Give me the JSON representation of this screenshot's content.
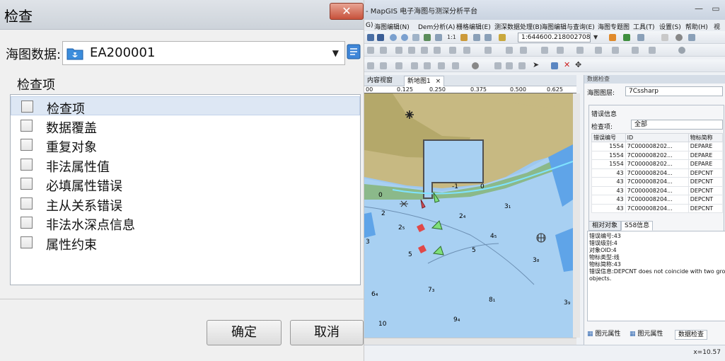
{
  "dialog": {
    "title": "检查",
    "close_glyph": "✕",
    "chart_data_label": "海图数据:",
    "chart_data_value": "EA200001",
    "group_label": "检查项",
    "items": [
      {
        "label": "检查项"
      },
      {
        "label": "数据覆盖"
      },
      {
        "label": "重复对象"
      },
      {
        "label": "非法属性值"
      },
      {
        "label": "必填属性错误"
      },
      {
        "label": "主从关系错误"
      },
      {
        "label": "非法水深点信息"
      },
      {
        "label": "属性约束"
      }
    ],
    "ok_label": "确定",
    "cancel_label": "取消"
  },
  "app": {
    "title": "- MapGIS 电子海图与测深分析平台",
    "menu": [
      "G)",
      "海图编辑(N)",
      "Dem分析(A)",
      "栅格编辑(E)",
      "测深数据处理(B)",
      "海图编辑与查询(E)",
      "海图专题图",
      "工具(T)",
      "设置(S)",
      "帮助(H)",
      "视"
    ],
    "scale_value": "1:644600.218002708",
    "tabs": [
      "内容视窗",
      "新地图1"
    ],
    "tab_close": "×",
    "ruler_ticks": [
      "00",
      "0.125",
      "0.250",
      "0.375",
      "0.500",
      "0.625"
    ],
    "map_labels": [
      "0",
      "2",
      "-1",
      "0",
      "2₄",
      "3₁",
      "2₅",
      "4₅",
      "3",
      "5",
      "5",
      "3₈",
      "6₄",
      "7₃",
      "8₁",
      "3₉",
      "9₄",
      "10"
    ],
    "panel": {
      "header": "数据检查",
      "layer_label": "海图图层:",
      "layer_value": "7Cssharp",
      "group_label": "错误信息",
      "check_label": "检查项:",
      "check_value": "全部",
      "columns": [
        "错误编号",
        "ID",
        "物标简称"
      ],
      "rows": [
        [
          "1554",
          "7C000008202...",
          "DEPARE"
        ],
        [
          "1554",
          "7C000008202...",
          "DEPARE"
        ],
        [
          "1554",
          "7C000008202...",
          "DEPARE"
        ],
        [
          "43",
          "7C000008204...",
          "DEPCNT"
        ],
        [
          "43",
          "7C000008204...",
          "DEPCNT"
        ],
        [
          "43",
          "7C000008204...",
          "DEPCNT"
        ],
        [
          "43",
          "7C000008204...",
          "DEPCNT"
        ],
        [
          "43",
          "7C000008204...",
          "DEPCNT"
        ]
      ],
      "info_tabs": [
        "相对对象",
        "S58信息"
      ],
      "info_lines": [
        "错误编号:43",
        "错误级别:4",
        "对象OID:4",
        "物标类型:线",
        "物标简称:43",
        "错误信息:DEPCNT does not coincide with two grou",
        "objects."
      ],
      "bottom_tabs": [
        "图元属性",
        "图元属性",
        "数据检查"
      ]
    },
    "status_text": "x=10.57"
  }
}
